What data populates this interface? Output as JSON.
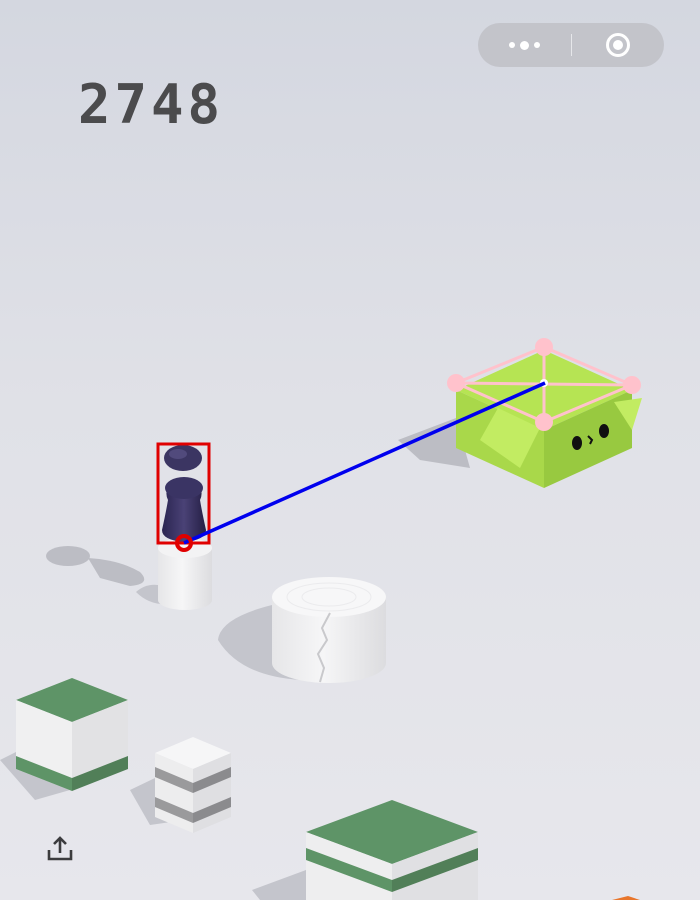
{
  "score": "2748",
  "icons": {
    "menu": "more-dots-icon",
    "close": "close-target-icon",
    "share": "share-icon"
  },
  "colors": {
    "background": "#dfe0e6",
    "score": "#4b4b4d",
    "capsule": "#c3c4ca",
    "target_box": "#a9d84a",
    "platform_green": "#5e9467",
    "player": "#3b3562",
    "player_box": "#e00000",
    "jump_line": "#0000ee",
    "target_marker": "#ffc2cc"
  }
}
